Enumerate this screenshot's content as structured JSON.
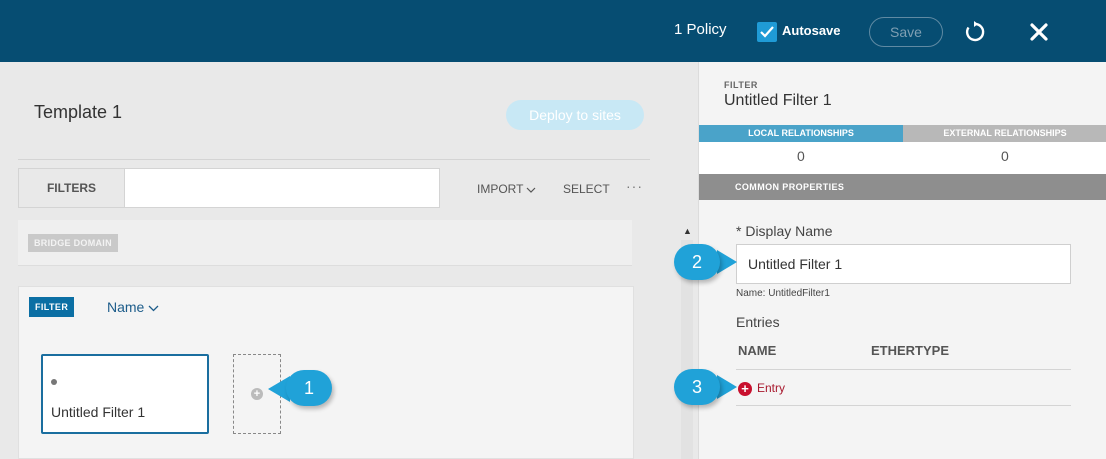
{
  "header": {
    "policy_count": "1 Policy",
    "autosave_label": "Autosave",
    "save_label": "Save"
  },
  "template": {
    "title": "Template 1",
    "deploy_label": "Deploy to sites"
  },
  "toolbar": {
    "filters_tab": "FILTERS",
    "import_label": "IMPORT",
    "select_label": "SELECT",
    "more_label": "···"
  },
  "bridge_domain": {
    "badge": "BRIDGE DOMAIN"
  },
  "filter_section": {
    "badge": "FILTER",
    "sort_label": "Name",
    "card_label": "Untitled Filter 1"
  },
  "callouts": {
    "one": "1",
    "two": "2",
    "three": "3"
  },
  "right_pane": {
    "kind": "FILTER",
    "title": "Untitled Filter 1",
    "local_tab": "LOCAL RELATIONSHIPS",
    "external_tab": "EXTERNAL RELATIONSHIPS",
    "local_count": "0",
    "external_count": "0",
    "common_properties": "COMMON PROPERTIES",
    "display_name_label": "* Display Name",
    "display_name_value": "Untitled Filter 1",
    "name_hint": "Name: UntitledFilter1",
    "entries_label": "Entries",
    "col_name": "NAME",
    "col_ethertype": "ETHERTYPE",
    "add_entry_label": "Entry"
  },
  "colors": {
    "header_bg": "#064d72",
    "accent": "#20a2d8",
    "filter_badge": "#0b6fa4",
    "danger": "#c8102e"
  }
}
